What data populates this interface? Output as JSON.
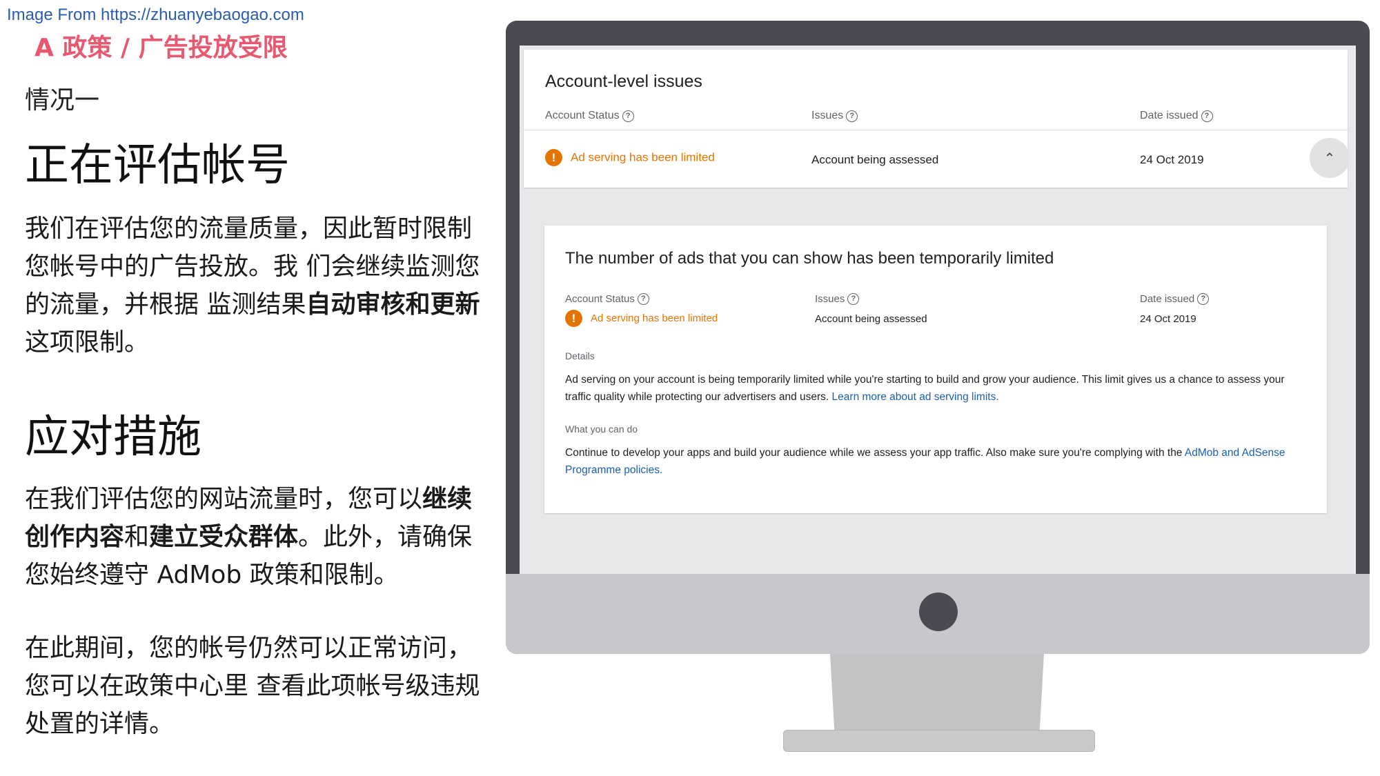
{
  "source": "Image From https://zhuanyebaogao.com",
  "section_title": "A 政策 /  广告投放受限",
  "case_label": "情况一",
  "heading1": "正在评估帐号",
  "para1": {
    "text_a": "我们在评估您的流量质量，因此暂时限制您帐号中的广告投放。我 们会继续监测您的流量，并根据 监测结果",
    "bold_a": "自动审核和更新",
    "text_b": "这项限制。"
  },
  "heading2": "应对措施",
  "para2": {
    "text_a": "在我们评估您的网站流量时，您可以",
    "bold_a": "继续创作内容",
    "text_b": "和",
    "bold_b": "建立受众群体",
    "text_c": "。此外，请确保您始终遵守 AdMob 政策和限制。"
  },
  "para3": "在此期间，您的帐号仍然可以正常访问，您可以在政策中心里 查看此项帐号级违规处置的详情。",
  "screen": {
    "card_title": "Account-level issues",
    "columns": {
      "account_status": "Account Status",
      "issues": "Issues",
      "date_issued": "Date issued"
    },
    "row": {
      "status": "Ad serving has been limited",
      "issue": "Account being assessed",
      "date": "24 Oct 2019"
    },
    "detail": {
      "title": "The number of ads that you can show has been temporarily limited",
      "details_label": "Details",
      "details_text": "Ad serving on your account is being temporarily limited while you're starting to build and grow your audience. This limit gives us a chance to assess your traffic quality while protecting our advertisers and users.",
      "details_link": "Learn more about ad serving limits.",
      "what_label": "What you can do",
      "what_text": "Continue to develop your apps and build your audience while we assess your app traffic. Also make sure you're complying with the",
      "what_link": "AdMob and AdSense Programme policies."
    }
  },
  "colors": {
    "section_title": "#e8586f",
    "warning": "#e37400",
    "link": "#1a5fb4",
    "monitor_frame": "#4a4a52"
  },
  "icons": {
    "help": "question-circle",
    "warning": "exclamation-circle",
    "collapse": "chevron-up"
  }
}
